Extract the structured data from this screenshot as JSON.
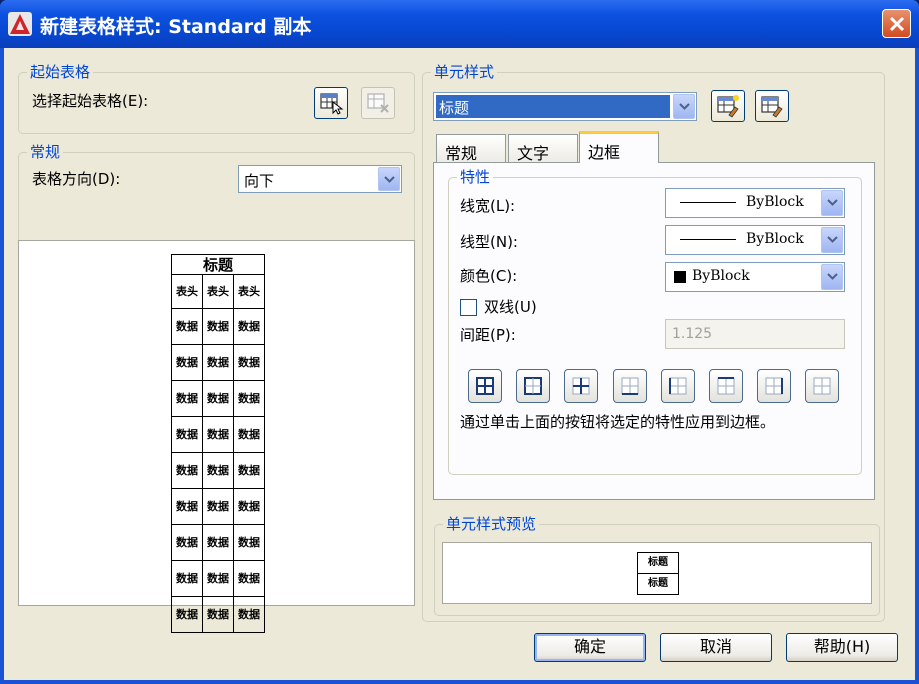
{
  "window": {
    "title": "新建表格样式: Standard 副本"
  },
  "start_table": {
    "group_title": "起始表格",
    "select_label": "选择起始表格(E):"
  },
  "general": {
    "group_title": "常规",
    "direction_label": "表格方向(D):",
    "direction_value": "向下"
  },
  "preview": {
    "title": "标题",
    "header_cell": "表头",
    "data_cell": "数据",
    "data_rows": 9,
    "columns": 3
  },
  "cell_style": {
    "group_title": "单元样式",
    "selected": "标题"
  },
  "tabs": [
    "常规",
    "文字",
    "边框"
  ],
  "active_tab": "边框",
  "properties": {
    "group_title": "特性",
    "lineweight_label": "线宽(L):",
    "lineweight_value": "ByBlock",
    "linetype_label": "线型(N):",
    "linetype_value": "ByBlock",
    "color_label": "颜色(C):",
    "color_value": "ByBlock",
    "double_line_label": "双线(U)",
    "double_line_checked": false,
    "spacing_label": "间距(P):",
    "spacing_value": "1.125",
    "hint": "通过单击上面的按钮将选定的特性应用到边框。"
  },
  "cell_preview": {
    "group_title": "单元样式预览",
    "cell_text": "标题"
  },
  "buttons": {
    "ok": "确定",
    "cancel": "取消",
    "help": "帮助(H)"
  },
  "colors": {
    "accent": "#0046d5",
    "titlebar": "#0a52e0",
    "active_tab_highlight": "#ffc83c"
  }
}
